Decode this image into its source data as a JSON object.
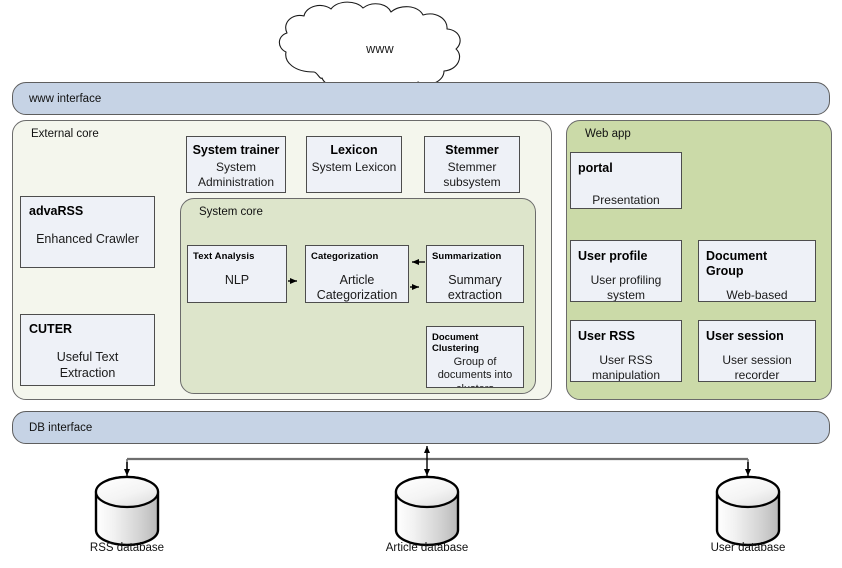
{
  "diagram": {
    "cloud": {
      "label": "www"
    },
    "bars": [
      {
        "id": "www-interface",
        "label": "www interface"
      },
      {
        "id": "db-interface",
        "label": "DB interface"
      }
    ],
    "panels": {
      "external_core": {
        "title": "External core"
      },
      "system_core": {
        "title": "System core"
      },
      "web_app": {
        "title": "Web app"
      }
    },
    "external_components": [
      {
        "id": "advarss",
        "title": "advaRSS",
        "body": "Enhanced Crawler"
      },
      {
        "id": "cuter",
        "title": "CUTER",
        "body": "Useful Text Extraction"
      }
    ],
    "support_components": [
      {
        "id": "system-trainer",
        "title": "System trainer",
        "body": "System\nAdministration"
      },
      {
        "id": "lexicon",
        "title": "Lexicon",
        "body": "System Lexicon"
      },
      {
        "id": "stemmer",
        "title": "Stemmer",
        "body": "Stemmer\nsubsystem"
      }
    ],
    "core_components": [
      {
        "id": "text-analysis",
        "title": "Text Analysis",
        "body": "NLP"
      },
      {
        "id": "categorization",
        "title": "Categorization",
        "body": "Article\nCategorization"
      },
      {
        "id": "summarization",
        "title": "Summarization",
        "body": "Summary\nextraction"
      },
      {
        "id": "document-clustering",
        "title": "Document\nClustering",
        "body": "Group of\ndocuments into\nclusters"
      }
    ],
    "web_components": [
      {
        "id": "portal",
        "title": "portal",
        "body": "Presentation layer"
      },
      {
        "id": "user-profile",
        "title": "User profile",
        "body": "User profiling\nsystem"
      },
      {
        "id": "document-group",
        "title": "Document Group",
        "body": "Web-based\ndocument group"
      },
      {
        "id": "user-rss",
        "title": "User RSS",
        "body": "User RSS\nmanipulation"
      },
      {
        "id": "user-session",
        "title": "User session",
        "body": "User session\nrecorder"
      }
    ],
    "databases": [
      {
        "id": "rss-database",
        "label": "RSS database"
      },
      {
        "id": "article-database",
        "label": "Article database"
      },
      {
        "id": "user-database",
        "label": "User database"
      }
    ],
    "colors": {
      "bar_fill": "#c6d3e5",
      "external_core_fill": "#f4f6ed",
      "system_core_fill": "#dde5cb",
      "web_app_fill": "#cbdaa8",
      "box_fill": "#eef1f7",
      "box_border": "#4d4d4d",
      "panel_border": "#6b6b6b",
      "connector": "#6e6e6e",
      "arrow": "#000000"
    }
  }
}
